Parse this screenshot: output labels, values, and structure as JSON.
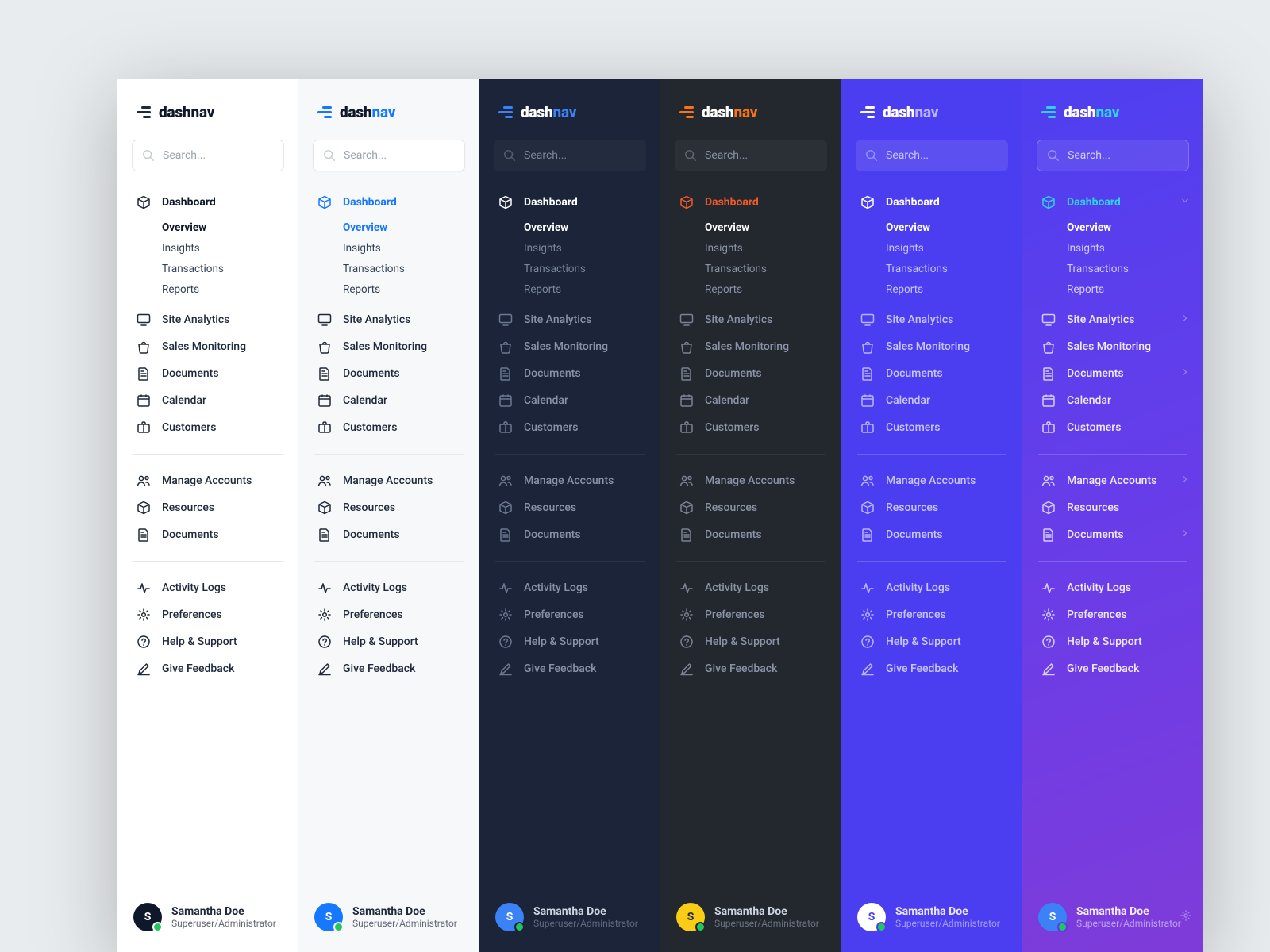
{
  "brand": {
    "part1": "dash",
    "part2": "nav"
  },
  "search": {
    "placeholder": "Search..."
  },
  "nav": {
    "dashboard": "Dashboard",
    "sub": {
      "overview": "Overview",
      "insights": "Insights",
      "transactions": "Transactions",
      "reports": "Reports"
    },
    "analytics": "Site Analytics",
    "sales": "Sales Monitoring",
    "documents": "Documents",
    "calendar": "Calendar",
    "customers": "Customers"
  },
  "group2": {
    "manage": "Manage Accounts",
    "resources": "Resources",
    "documents": "Documents"
  },
  "group3": {
    "activity": "Activity Logs",
    "preferences": "Preferences",
    "help": "Help & Support",
    "feedback": "Give Feedback"
  },
  "user": {
    "initial": "S",
    "name": "Samantha Doe",
    "role": "Superuser/Administrator"
  }
}
